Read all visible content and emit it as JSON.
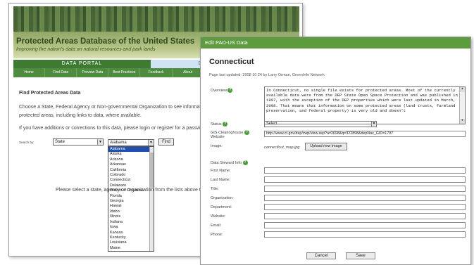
{
  "back_page": {
    "title": "Protected Areas Database of the United States",
    "subtitle": "Improving the nation's data on natural resources and park lands",
    "nav_top": [
      "DATA PORTAL",
      "DESIGN PROJECT"
    ],
    "nav": [
      "Home",
      "Find Data",
      "Preview Data",
      "Best Practices",
      "Feedback",
      "About",
      "",
      "",
      ""
    ],
    "heading": "Find Protected Areas Data",
    "paragraph": "Choose a State, Federal Agency or Non-governmental Organization to see information on protected areas, including links to data, where available.",
    "paragraph2": "If you have additions or corrections to this data, please login or register for a password.",
    "search_by_label": "Search by:",
    "search_by_value": "State",
    "state_value": "Alabama",
    "find_label": "Find",
    "bottom_text": "Please select a state, agency or organization from the lists above to search for information on the",
    "states": [
      "Alabama",
      "Alaska",
      "Arizona",
      "Arkansas",
      "California",
      "Colorado",
      "Connecticut",
      "Delaware",
      "District of Columbia",
      "Florida",
      "Georgia",
      "Hawaii",
      "Idaho",
      "Illinois",
      "Indiana",
      "Iowa",
      "Kansas",
      "Kentucky",
      "Louisiana",
      "Maine"
    ]
  },
  "dialog": {
    "bar_title": "Edit PAD-US Data",
    "title": "Connecticut",
    "updated": "Page last updated: 2008 10 24 by Larry Orman, GreenInfo Network",
    "overview_label": "Overview",
    "overview_text": "In Connecticut, no single file exists for protected areas. Most of the currently available data were from the DEP State Open Space Protection and was published in 1997, with the exception of the DEP properties which were last updated in March, 2008. That means that information on some protected areas (land trusts, farmland preservation, and federal property) is very old and doesn't",
    "status_label": "Status",
    "status_value": "Select",
    "gis_label_1": "GIS Clearinghouse",
    "gis_label_2": "Website",
    "gis_value": "http://www.ct.gov/dep/cwp/view.asp?a=2698&q=322898&depNav_GID=1707",
    "image_label": "Image:",
    "image_name": "connecticut_map.jpg",
    "upload_label": "Upload new image",
    "steward_label": "Data Steward Info",
    "fields": [
      "First Name:",
      "Last Name:",
      "Title:",
      "Organization:",
      "Department:",
      "Website:",
      "Email:",
      "Phone:"
    ],
    "cancel_label": "Cancel",
    "save_label": "Save"
  }
}
